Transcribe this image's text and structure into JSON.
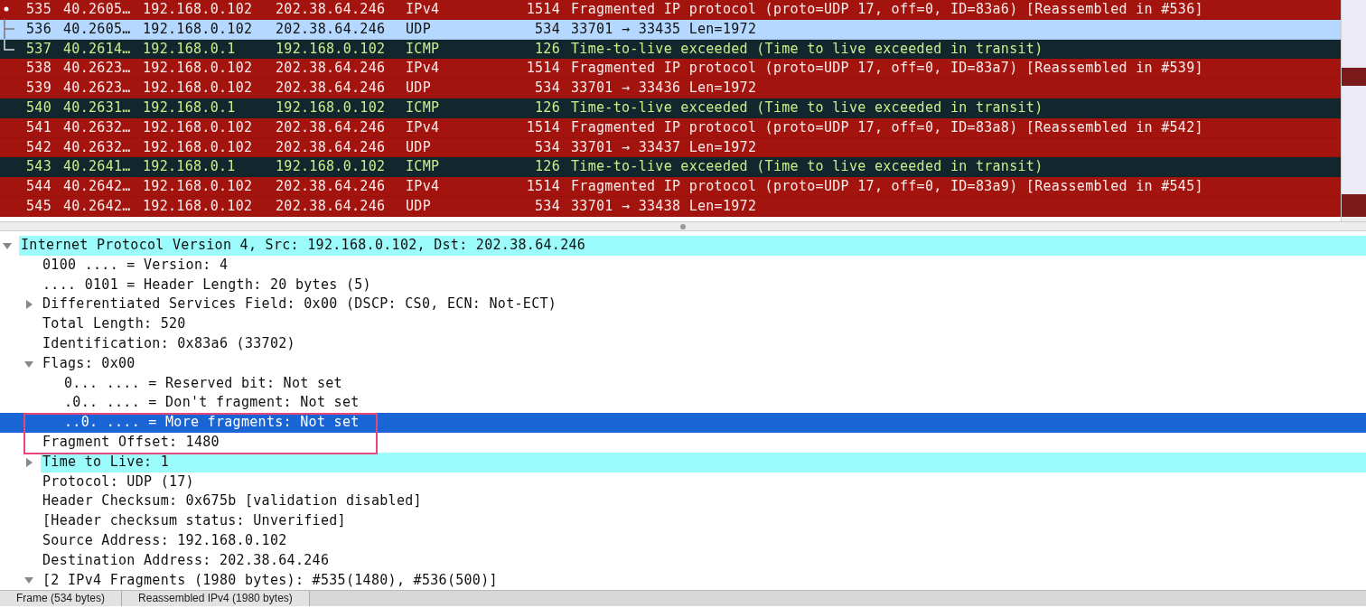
{
  "packet_list": {
    "rows": [
      {
        "no": "535",
        "time": "40.2605…",
        "source": "192.168.0.102",
        "destination": "202.38.64.246",
        "protocol": "IPv4",
        "length": "1514",
        "info": "Fragmented IP protocol (proto=UDP 17, off=0, ID=83a6) [Reassembled in #536]",
        "kind": "error",
        "selected": false,
        "related": {
          "kind": "first"
        }
      },
      {
        "no": "536",
        "time": "40.2605…",
        "source": "192.168.0.102",
        "destination": "202.38.64.246",
        "protocol": "UDP",
        "length": "534",
        "info": "33701 → 33435 Len=1972",
        "kind": "error",
        "selected": true,
        "related": {
          "kind": "middle"
        }
      },
      {
        "no": "537",
        "time": "40.2614…",
        "source": "192.168.0.1",
        "destination": "192.168.0.102",
        "protocol": "ICMP",
        "length": "126",
        "info": "Time-to-live exceeded (Time to live exceeded in transit)",
        "kind": "icmp",
        "selected": false,
        "related": {
          "kind": "last"
        }
      },
      {
        "no": "538",
        "time": "40.2623…",
        "source": "192.168.0.102",
        "destination": "202.38.64.246",
        "protocol": "IPv4",
        "length": "1514",
        "info": "Fragmented IP protocol (proto=UDP 17, off=0, ID=83a7) [Reassembled in #539]",
        "kind": "error",
        "selected": false
      },
      {
        "no": "539",
        "time": "40.2623…",
        "source": "192.168.0.102",
        "destination": "202.38.64.246",
        "protocol": "UDP",
        "length": "534",
        "info": "33701 → 33436 Len=1972",
        "kind": "error",
        "selected": false
      },
      {
        "no": "540",
        "time": "40.2631…",
        "source": "192.168.0.1",
        "destination": "192.168.0.102",
        "protocol": "ICMP",
        "length": "126",
        "info": "Time-to-live exceeded (Time to live exceeded in transit)",
        "kind": "icmp",
        "selected": false
      },
      {
        "no": "541",
        "time": "40.2632…",
        "source": "192.168.0.102",
        "destination": "202.38.64.246",
        "protocol": "IPv4",
        "length": "1514",
        "info": "Fragmented IP protocol (proto=UDP 17, off=0, ID=83a8) [Reassembled in #542]",
        "kind": "error",
        "selected": false
      },
      {
        "no": "542",
        "time": "40.2632…",
        "source": "192.168.0.102",
        "destination": "202.38.64.246",
        "protocol": "UDP",
        "length": "534",
        "info": "33701 → 33437 Len=1972",
        "kind": "error",
        "selected": false
      },
      {
        "no": "543",
        "time": "40.2641…",
        "source": "192.168.0.1",
        "destination": "192.168.0.102",
        "protocol": "ICMP",
        "length": "126",
        "info": "Time-to-live exceeded (Time to live exceeded in transit)",
        "kind": "icmp",
        "selected": false
      },
      {
        "no": "544",
        "time": "40.2642…",
        "source": "192.168.0.102",
        "destination": "202.38.64.246",
        "protocol": "IPv4",
        "length": "1514",
        "info": "Fragmented IP protocol (proto=UDP 17, off=0, ID=83a9) [Reassembled in #545]",
        "kind": "error",
        "selected": false
      },
      {
        "no": "545",
        "time": "40.2642…",
        "source": "192.168.0.102",
        "destination": "202.38.64.246",
        "protocol": "UDP",
        "length": "534",
        "info": "33701 → 33438 Len=1972",
        "kind": "error",
        "selected": false
      }
    ]
  },
  "details": {
    "items": [
      {
        "text": "Internet Protocol Version 4, Src: 192.168.0.102, Dst: 202.38.64.246",
        "expanded": true,
        "highlighted": true,
        "selected": false,
        "children": [
          {
            "text": "0100 .... = Version: 4",
            "highlighted": false,
            "selected": false
          },
          {
            "text": ".... 0101 = Header Length: 20 bytes (5)",
            "highlighted": false,
            "selected": false
          },
          {
            "text": "Differentiated Services Field: 0x00 (DSCP: CS0, ECN: Not-ECT)",
            "expanded": false,
            "highlighted": false,
            "selected": false
          },
          {
            "text": "Total Length: 520",
            "highlighted": false,
            "selected": false
          },
          {
            "text": "Identification: 0x83a6 (33702)",
            "highlighted": false,
            "selected": false
          },
          {
            "text": "Flags: 0x00",
            "expanded": true,
            "highlighted": false,
            "selected": false,
            "children": [
              {
                "text": "0... .... = Reserved bit: Not set",
                "highlighted": false,
                "selected": false
              },
              {
                "text": ".0.. .... = Don't fragment: Not set",
                "highlighted": false,
                "selected": false
              },
              {
                "text": "..0. .... = More fragments: Not set",
                "highlighted": false,
                "selected": true
              }
            ]
          },
          {
            "text": "Fragment Offset: 1480",
            "highlighted": false,
            "selected": false
          },
          {
            "text": "Time to Live: 1",
            "expanded": false,
            "highlighted": true,
            "selected": false
          },
          {
            "text": "Protocol: UDP (17)",
            "highlighted": false,
            "selected": false
          },
          {
            "text": "Header Checksum: 0x675b [validation disabled]",
            "highlighted": false,
            "selected": false
          },
          {
            "text": "[Header checksum status: Unverified]",
            "highlighted": false,
            "selected": false
          },
          {
            "text": "Source Address: 192.168.0.102",
            "highlighted": false,
            "selected": false
          },
          {
            "text": "Destination Address: 202.38.64.246",
            "highlighted": false,
            "selected": false
          },
          {
            "text": "[2 IPv4 Fragments (1980 bytes): #535(1480), #536(500)]",
            "expanded": true,
            "highlighted": false,
            "selected": false
          }
        ]
      }
    ]
  },
  "status_bar": {
    "tabs": [
      "Frame (534 bytes)",
      "Reassembled IPv4 (1980 bytes)"
    ]
  }
}
